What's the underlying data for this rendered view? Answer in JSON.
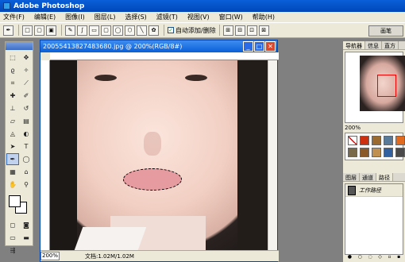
{
  "window": {
    "title": "Adobe Photoshop"
  },
  "menu": [
    "文件(F)",
    "编辑(E)",
    "图像(I)",
    "图层(L)",
    "选择(S)",
    "滤镜(T)",
    "视图(V)",
    "窗口(W)",
    "帮助(H)"
  ],
  "options_bar": {
    "auto_add_delete_label": "自动添加/删除",
    "auto_add_delete_checked": true,
    "brush_button": "画笔"
  },
  "document": {
    "title": "20055413827483680.jpg @ 200%(RGB/8#)",
    "zoom": "200%",
    "doc_info": "文档:1.02M/1.02M"
  },
  "panels": {
    "top_tabs": [
      "导航器",
      "信息",
      "直方"
    ],
    "navigator_zoom": "200%",
    "bottom_tabs": [
      "图层",
      "通道",
      "路径"
    ],
    "active_bottom_tab": "路径",
    "path_item": "工作路径"
  },
  "colors": {
    "accent": "#0a5fd8",
    "chrome": "#ece9d8",
    "workspace": "#808080"
  }
}
